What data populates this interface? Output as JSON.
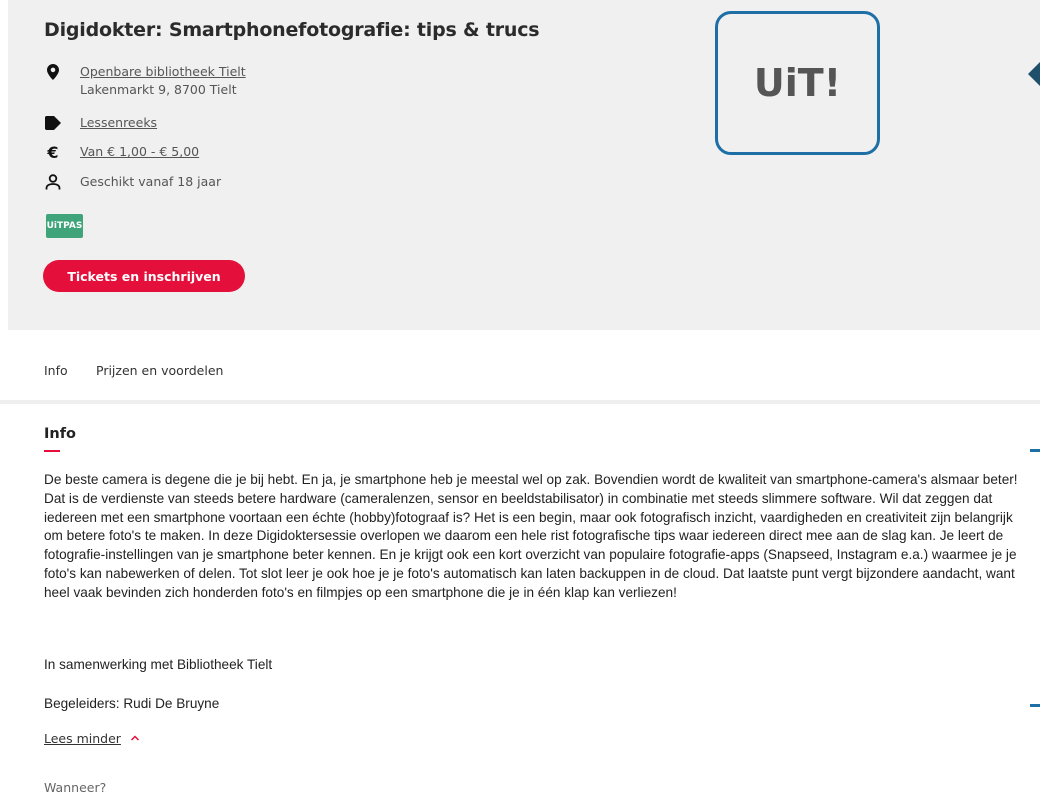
{
  "event": {
    "title": "Digidokter: Smartphonefotografie: tips & trucs",
    "location_name": "Openbare bibliotheek Tielt",
    "location_address": "Lakenmarkt 9, 8700 Tielt",
    "category": "Lessenreeks",
    "price": "Van € 1,00 - € 5,00",
    "age": "Geschikt vanaf 18 jaar",
    "badge": "UiTPAS",
    "tickets_label": "Tickets en inschrijven"
  },
  "logo": {
    "text": "UiT!",
    "border_color": "#1d6fa5"
  },
  "icons": {
    "location": "map-pin-icon",
    "tag": "tag-icon",
    "price": "euro-icon",
    "age": "person-icon",
    "expand": "chevron-up-icon",
    "nav": "arrow-left-icon"
  },
  "tabs": [
    {
      "label": "Info"
    },
    {
      "label": "Prijzen en voordelen"
    }
  ],
  "info": {
    "title": "Info",
    "paragraph_1": "De beste camera is degene die je bij hebt. En ja, je smartphone heb je meestal wel op zak. Bovendien wordt de kwaliteit van smartphone-camera's alsmaar beter! Dat is de verdienste van steeds betere hardware (cameralenzen, sensor en beeldstabilisator) in combinatie met steeds slimmere software. Wil dat zeggen dat iedereen met een smartphone voortaan een échte (hobby)fotograaf is? Het is een begin, maar ook fotografisch inzicht, vaardigheden en creativiteit zijn belangrijk om betere foto's te maken. In deze Digidoktersessie overlopen we daarom een hele rist fotografische tips waar iedereen direct mee aan de slag kan. Je leert de fotografie-instellingen van je smartphone beter kennen. En je krijgt ook een kort overzicht van populaire fotografie-apps (Snapseed, Instagram e.a.) waarmee je je foto's kan nabewerken of delen. Tot slot leer je ook hoe je je foto's automatisch kan laten backuppen in de cloud. Dat laatste punt vergt bijzondere aandacht, want heel vaak bevinden zich honderden foto's en filmpjes op een smartphone die je in één klap kan verliezen!",
    "paragraph_2": "In samenwerking met Bibliotheek Tielt",
    "paragraph_3": "Begeleiders: Rudi De Bruyne",
    "read_less": "Lees minder",
    "when_label": "Wanneer?"
  },
  "colors": {
    "accent": "#e4103b",
    "badge_green": "#3fa47a",
    "hero_bg": "#f0f0f0",
    "brand_blue": "#1d6fa5"
  }
}
